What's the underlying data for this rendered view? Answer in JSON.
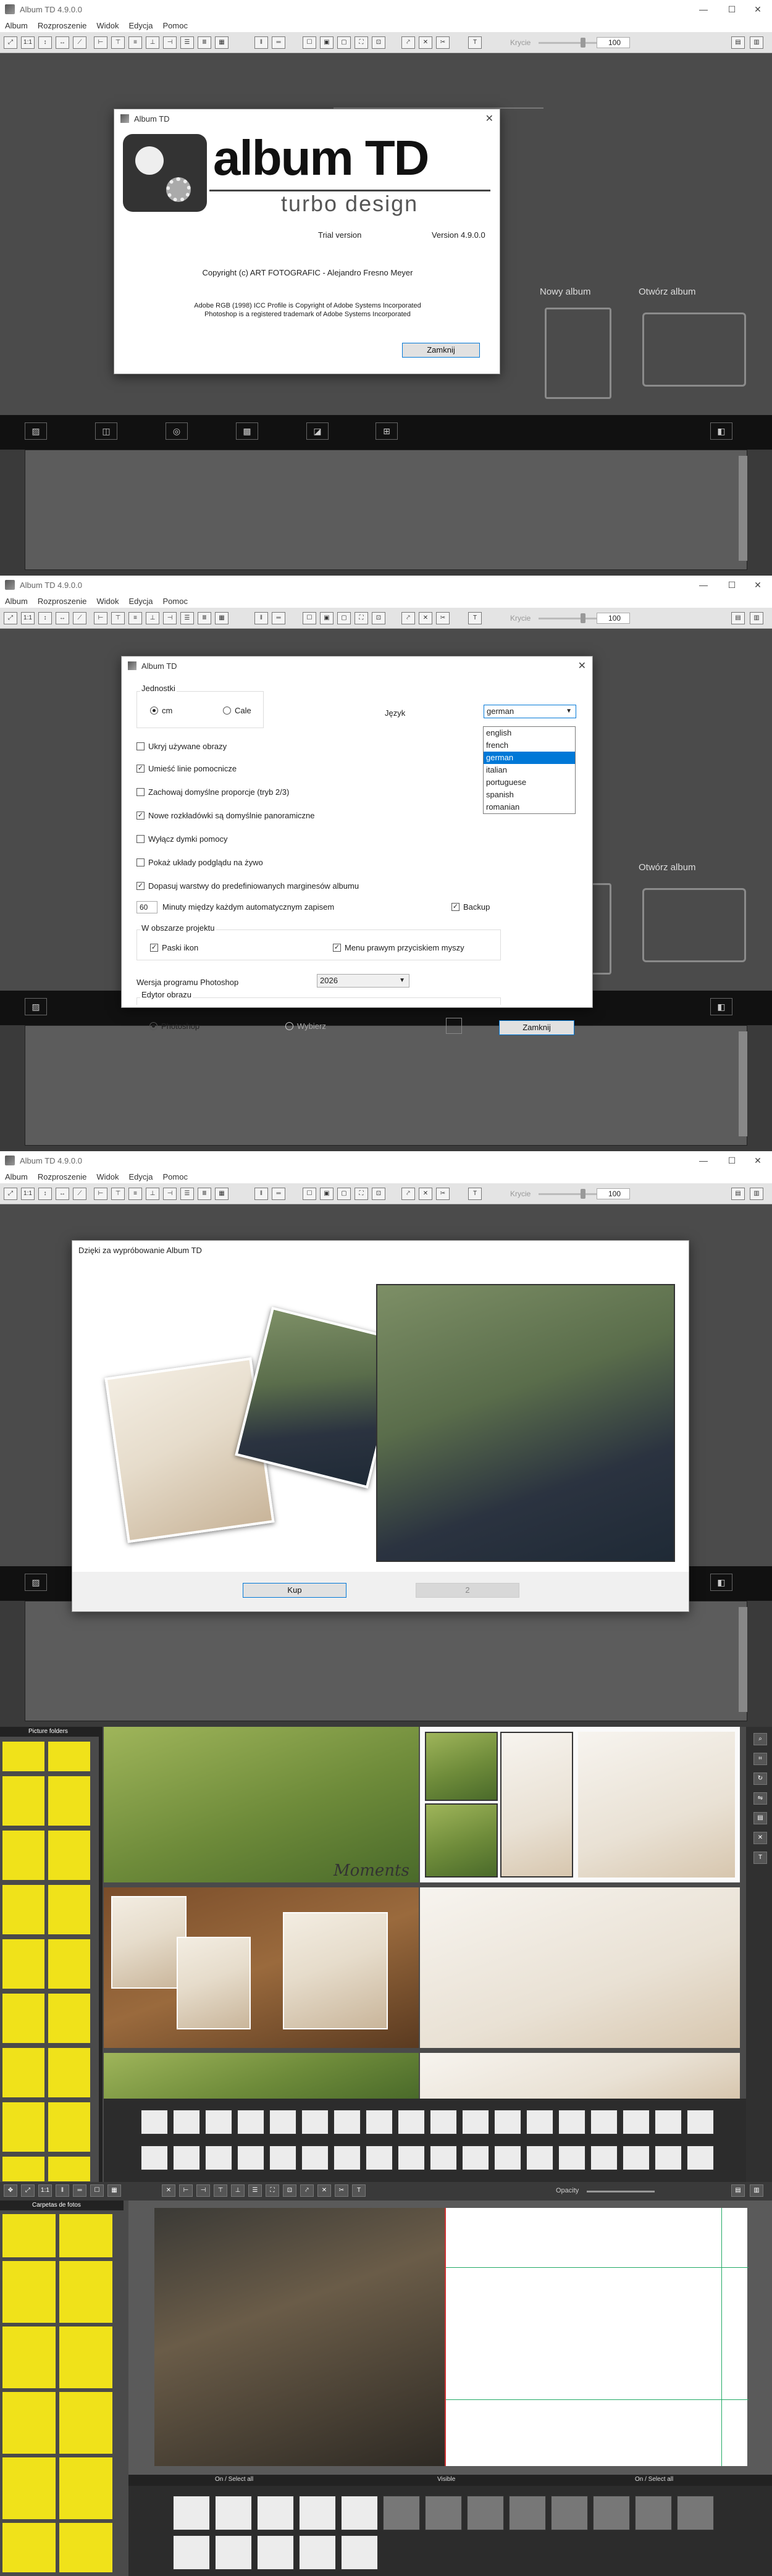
{
  "window": {
    "title": "Album TD 4.9.0.0",
    "minimize": "—",
    "maximize": "☐",
    "close": "✕"
  },
  "menu": [
    "Album",
    "Rozproszenie",
    "Widok",
    "Edycja",
    "Pomoc"
  ],
  "toolbar": {
    "opacity_label": "Krycie",
    "opacity_value": "100",
    "one_to_one": "1:1"
  },
  "start": {
    "new_album": "Nowy album",
    "open_album": "Otwórz album"
  },
  "about": {
    "title": "Album TD",
    "logo_main": "album TD",
    "logo_sub": "turbo design",
    "edition": "Trial version",
    "version": "Version 4.9.0.0",
    "copyright": "Copyright (c) ART FOTOGRAFIC - Alejandro Fresno Meyer",
    "legal_line1": "Adobe RGB (1998) ICC Profile is Copyright of Adobe Systems Incorporated",
    "legal_line2": "Photoshop is a registered trademark of Adobe Systems Incorporated",
    "close_button": "Zamknij"
  },
  "settings": {
    "title": "Album TD",
    "units_group": "Jednostki",
    "unit_cm": "cm",
    "unit_inch": "Cale",
    "language_label": "Język",
    "language_selected": "german",
    "language_options": [
      "english",
      "french",
      "german",
      "italian",
      "portuguese",
      "spanish",
      "romanian"
    ],
    "options": [
      {
        "label": "Ukryj używane obrazy",
        "checked": false
      },
      {
        "label": "Umieść linie pomocnicze",
        "checked": true
      },
      {
        "label": "Zachowaj domyślne proporcje (tryb 2/3)",
        "checked": false
      },
      {
        "label": "Nowe rozkładówki są domyślnie panoramiczne",
        "checked": true
      },
      {
        "label": "Wyłącz dymki pomocy",
        "checked": false
      },
      {
        "label": "Pokaż układy podglądu na żywo",
        "checked": false
      },
      {
        "label": "Dopasuj warstwy do predefiniowanych marginesów albumu",
        "checked": true
      }
    ],
    "autosave_value": "60",
    "autosave_label": "Minuty między każdym automatycznym zapisem",
    "backup_label": "Backup",
    "project_group": "W obszarze projektu",
    "icon_bars": "Paski ikon",
    "right_click_menu": "Menu prawym przyciskiem myszy",
    "photoshop_version_label": "Wersja programu Photoshop",
    "photoshop_version": "2026",
    "editor_group": "Edytor obrazu",
    "editor_photoshop": "Photoshop",
    "editor_choose": "Wybierz",
    "close_button": "Zamknij"
  },
  "trial": {
    "message": "Dzięki za wypróbowanie Album TD",
    "buy_button": "Kup",
    "counter": "2"
  },
  "editor1": {
    "folder_title": "Picture folders",
    "moment_text": "Moments"
  },
  "editor2": {
    "folder_title": "Carpetas de fotos",
    "opacity_label": "Opacity",
    "left_page_label": "On / Select all",
    "center_label": "Visible",
    "right_page_label": "On / Select all"
  },
  "colors": {
    "accent": "#0078d7",
    "workspace": "#4b4b4b",
    "thumb_bg": "#f0e21a"
  }
}
